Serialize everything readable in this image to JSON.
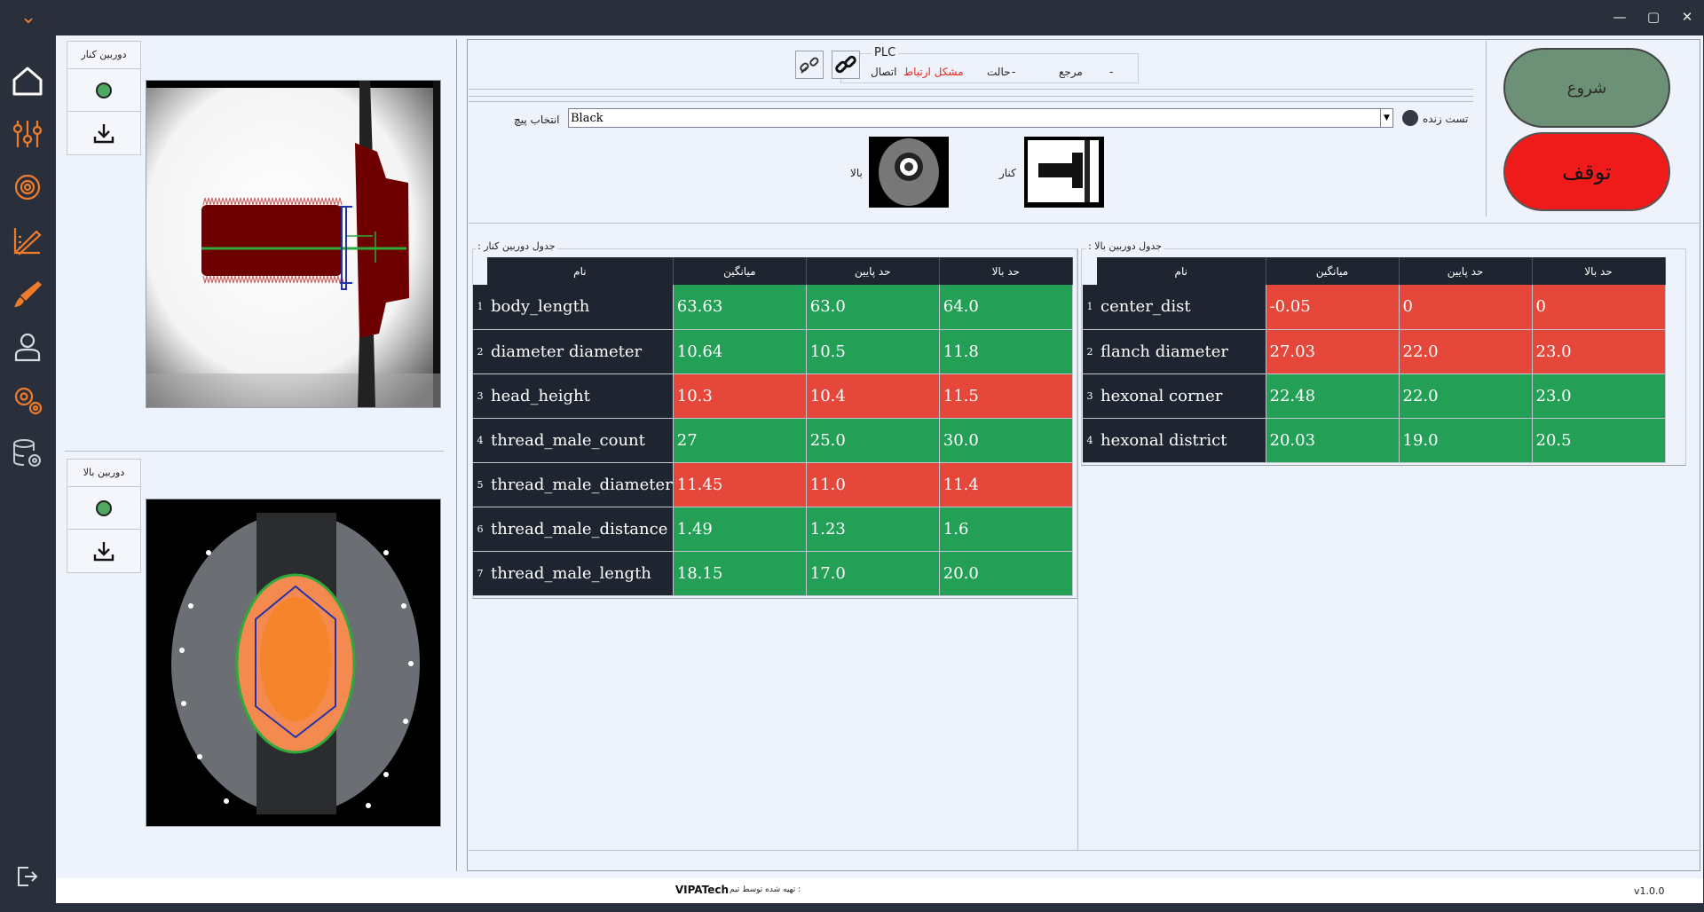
{
  "window": {
    "collapse_glyph": "⌄",
    "minimize": "—",
    "maximize": "▢",
    "close": "✕"
  },
  "sidebar": {
    "items": [
      {
        "name": "home-icon"
      },
      {
        "name": "sliders-icon"
      },
      {
        "name": "gear-flower-icon"
      },
      {
        "name": "ruler-pencil-icon"
      },
      {
        "name": "brush-icon"
      },
      {
        "name": "user-icon"
      },
      {
        "name": "settings-icon"
      },
      {
        "name": "database-gear-icon"
      }
    ],
    "logout": {
      "name": "logout-icon"
    }
  },
  "side_camera": {
    "title": "دوربین کنار"
  },
  "top_camera": {
    "title": "دوربین بالا"
  },
  "plc": {
    "title": "PLC",
    "connection_label": "اتصال",
    "connection_status": "مشکل ارتباط",
    "state_label": "حالت",
    "state_value": "-",
    "reference_label": "مرجع",
    "reference_value": "-"
  },
  "screw_select": {
    "label": "انتخاب پیچ",
    "value": "Black",
    "live_test_label": "تست زنده"
  },
  "thumbnails": {
    "top_label": "بالا",
    "side_label": "کنار"
  },
  "buttons": {
    "start": "شروع",
    "stop": "توقف"
  },
  "side_table": {
    "title": ": جدول دوربین کنار",
    "headers": {
      "name": "نام",
      "mean": "میانگین",
      "lower": "حد پایین",
      "upper": "حد بالا"
    },
    "rows": [
      {
        "idx": "1",
        "name": "body_length",
        "mean": "63.63",
        "lower": "63.0",
        "upper": "64.0",
        "status": "ok"
      },
      {
        "idx": "2",
        "name": "diameter diameter",
        "mean": "10.64",
        "lower": "10.5",
        "upper": "11.8",
        "status": "ok"
      },
      {
        "idx": "3",
        "name": "head_height",
        "mean": "10.3",
        "lower": "10.4",
        "upper": "11.5",
        "status": "bad"
      },
      {
        "idx": "4",
        "name": "thread_male_count",
        "mean": "27",
        "lower": "25.0",
        "upper": "30.0",
        "status": "ok"
      },
      {
        "idx": "5",
        "name": "thread_male_diameter",
        "mean": "11.45",
        "lower": "11.0",
        "upper": "11.4",
        "status": "bad"
      },
      {
        "idx": "6",
        "name": "thread_male_distance",
        "mean": "1.49",
        "lower": "1.23",
        "upper": "1.6",
        "status": "ok"
      },
      {
        "idx": "7",
        "name": "thread_male_length",
        "mean": "18.15",
        "lower": "17.0",
        "upper": "20.0",
        "status": "ok"
      }
    ]
  },
  "top_table": {
    "title": ": جدول دوربین بالا",
    "headers": {
      "name": "نام",
      "mean": "میانگین",
      "lower": "حد پایین",
      "upper": "حد بالا"
    },
    "rows": [
      {
        "idx": "1",
        "name": "center_dist",
        "mean": "-0.05",
        "lower": "0",
        "upper": "0",
        "status": "bad"
      },
      {
        "idx": "2",
        "name": "flanch diameter",
        "mean": "27.03",
        "lower": "22.0",
        "upper": "23.0",
        "status": "bad"
      },
      {
        "idx": "3",
        "name": "hexonal corner",
        "mean": "22.48",
        "lower": "22.0",
        "upper": "23.0",
        "status": "ok"
      },
      {
        "idx": "4",
        "name": "hexonal district",
        "mean": "20.03",
        "lower": "19.0",
        "upper": "20.5",
        "status": "ok"
      }
    ]
  },
  "footer": {
    "credit_prefix": "تهیه شده توسط تیم :",
    "credit_team": "VIPATech",
    "version": "v1.0.0"
  },
  "colors": {
    "ok": "#23a056",
    "bad": "#e5483a",
    "accent": "#f07c2a",
    "sidebar": "#2a303b"
  }
}
